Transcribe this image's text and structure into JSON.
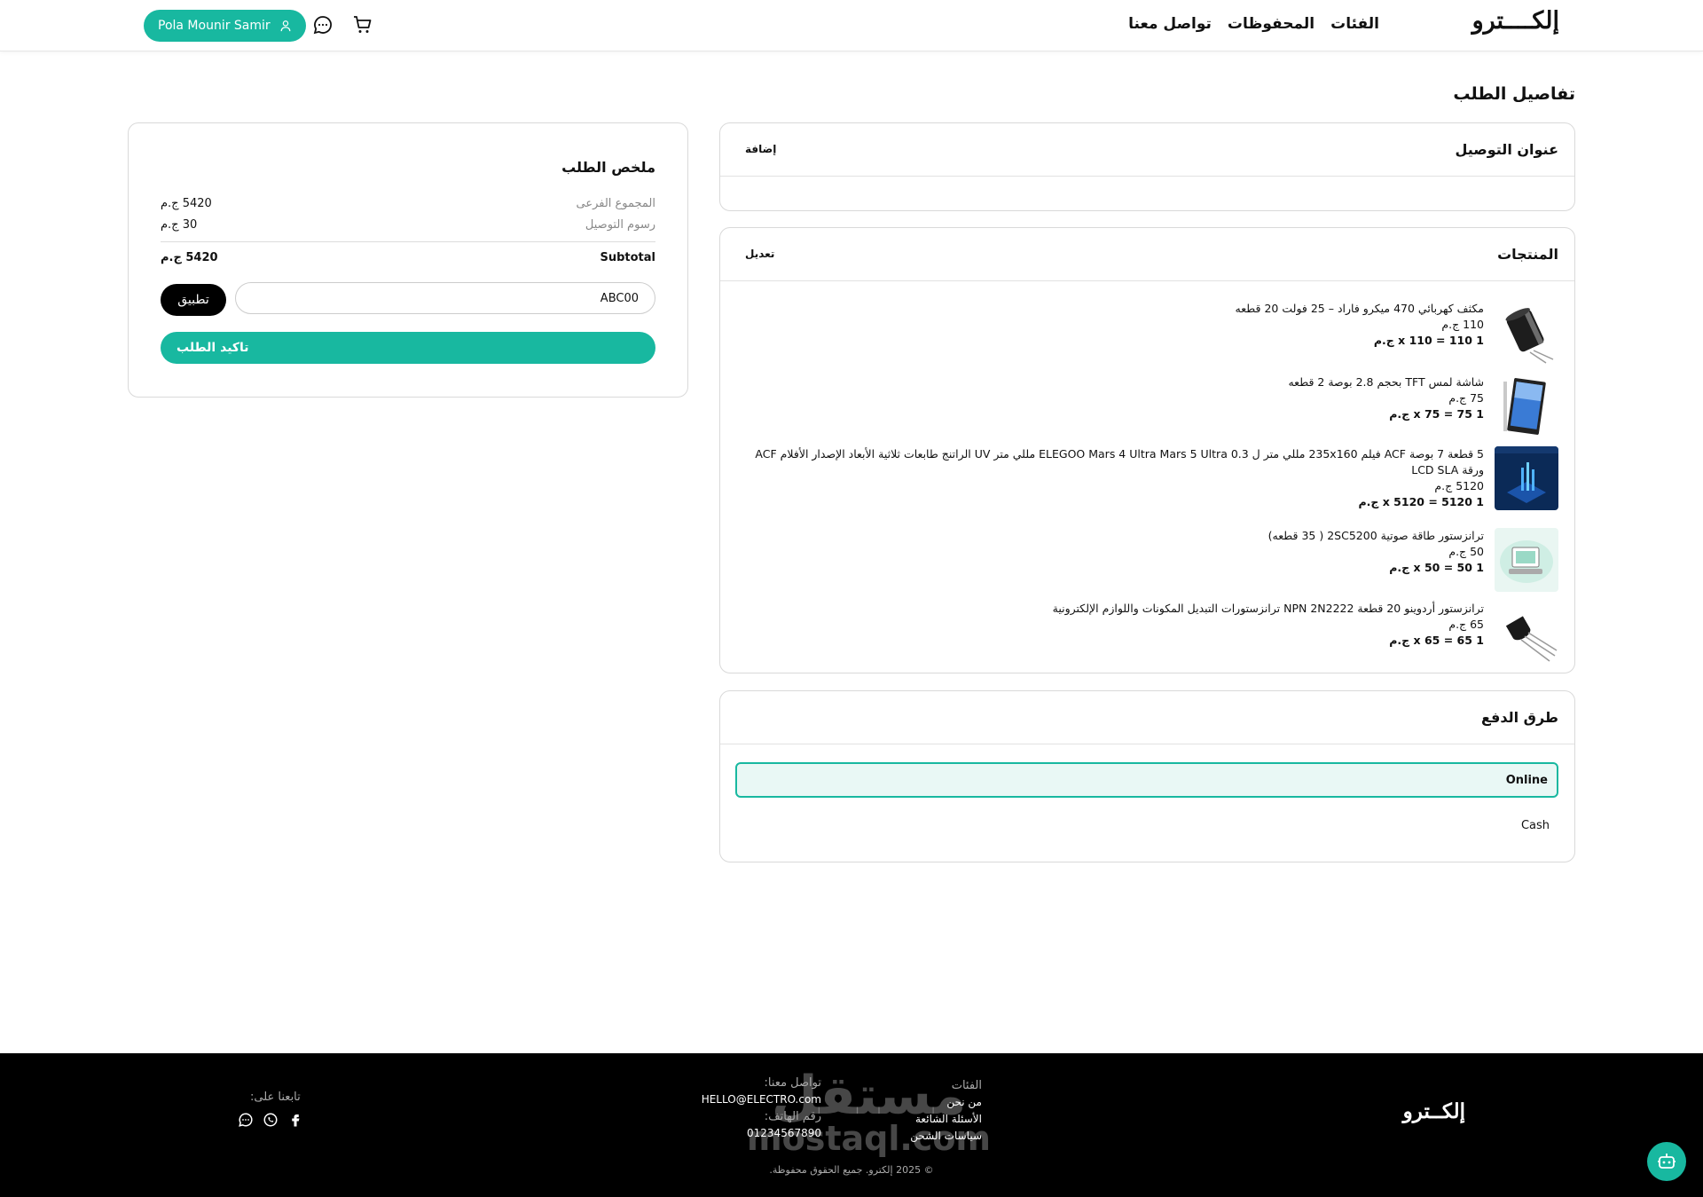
{
  "header": {
    "logo": "إلكــــترو",
    "nav": [
      "الفئات",
      "المحفوظات",
      "تواصل معنا"
    ],
    "user_name": "Pola Mounir Samir",
    "icons": [
      "cart-icon",
      "chat-icon",
      "user-icon"
    ]
  },
  "page_title": "تفاصيل الطلب",
  "address": {
    "title": "عنوان التوصيل",
    "action": "إضافة"
  },
  "products_section": {
    "title": "المنتجات",
    "action": "تعديل",
    "items": [
      {
        "name": "مكثف كهربائي 470 ميكرو فاراد – 25 فولت 20 قطعه",
        "price": "110 ج.م",
        "line": "1 x 110 = 110 ج.م",
        "image": "capacitor-image"
      },
      {
        "name": "شاشة لمس TFT بحجم 2.8 بوصة 2 قطعه",
        "price": "75 ج.م",
        "line": "1 x 75 = 75 ج.م",
        "image": "tft-screen-image"
      },
      {
        "name": "5 قطعة 7 بوصة ACF فيلم 235x160 مللي متر ل ELEGOO Mars 4 Ultra Mars 5 Ultra 0.3 مللي متر UV الراتنج طابعات ثلاثية الأبعاد الإصدار الأفلام ACF ورقة LCD SLA",
        "price": "5120 ج.م",
        "line": "1 x 5120 = 5120 ج.م",
        "image": "acf-film-image"
      },
      {
        "name": "ترانزستور طاقة صوتية 2SC5200 ( 35 قطعه)",
        "price": "50 ج.م",
        "line": "1 x 50 = 50 ج.م",
        "image": "transistor-power-image"
      },
      {
        "name": "ترانزستور أردوينو 20 قطعة NPN 2N2222 ترانزستورات التبديل المكونات واللوازم الإلكترونية",
        "price": "65 ج.م",
        "line": "1 x 65 = 65 ج.م",
        "image": "transistor-image"
      }
    ]
  },
  "payment": {
    "title": "طرق الدفع",
    "options": [
      "Online",
      "Cash"
    ],
    "selected": "Online"
  },
  "summary": {
    "title": "ملخص الطلب",
    "subtotal_label": "المجموع الفرعى",
    "subtotal_value": "5420 ج.م",
    "delivery_label": "رسوم التوصيل",
    "delivery_value": "30 ج.م",
    "total_label": "Subtotal",
    "total_value": "5420 ج.م",
    "coupon_value": "ABC00",
    "apply_label": "تطبيق",
    "confirm_label": "تاكيد الطلب"
  },
  "footer": {
    "logo": "إلكــترو",
    "categories_title": "الفئات",
    "links": [
      "من نحن",
      "الأسئلة الشائعة",
      "سياسات الشحن"
    ],
    "contact_title": "تواصل معنا:",
    "email": "HELLO@ELECTRO.com",
    "phone_label": "رقم الهاتف:",
    "phone": "01234567890",
    "follow_title": "تابعنا على:",
    "copyright": "© 2025 إلكترو. جميع الحقوق محفوظة.",
    "watermark_ar": "مستقل",
    "watermark_en": "mostaql.com"
  },
  "colors": {
    "accent": "#18b8a0",
    "footer_bg": "#000000"
  }
}
